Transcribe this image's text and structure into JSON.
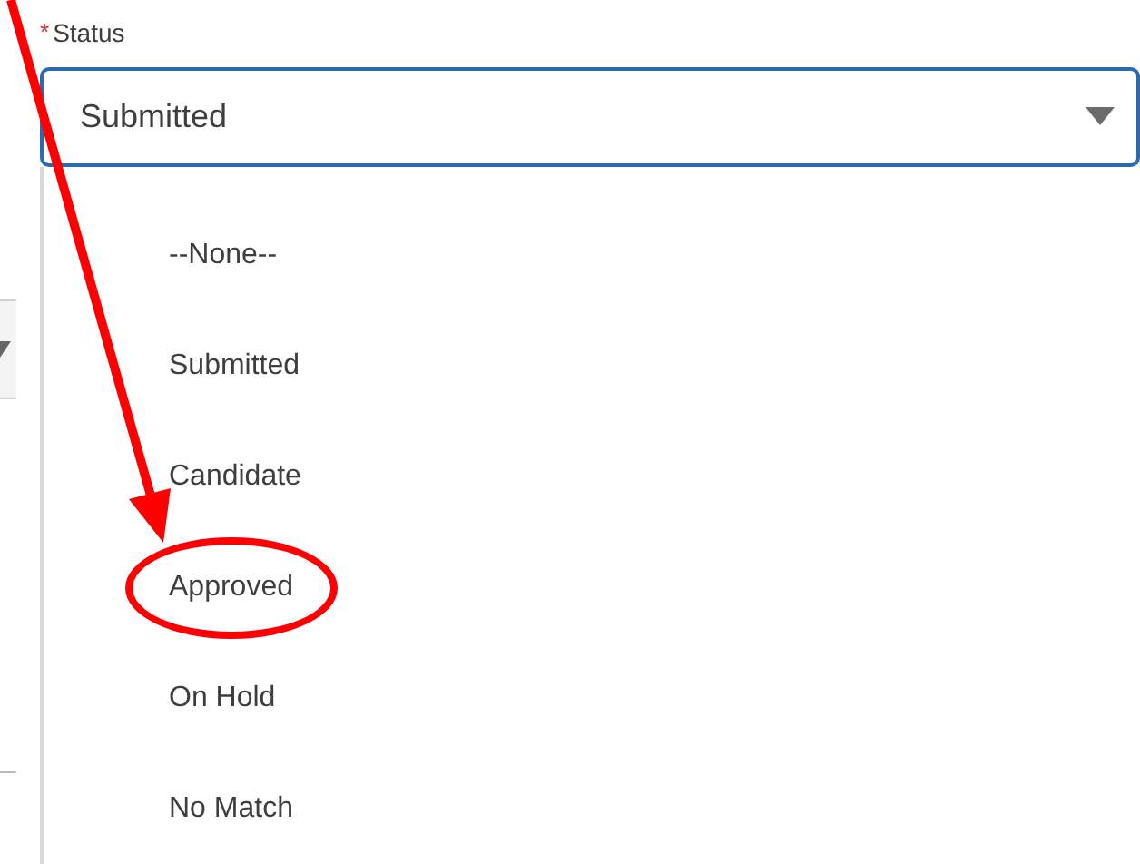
{
  "field": {
    "label": "Status",
    "required_mark": "*",
    "value": "Submitted"
  },
  "options": [
    {
      "label": "--None--",
      "circled": false
    },
    {
      "label": "Submitted",
      "circled": false
    },
    {
      "label": "Candidate",
      "circled": false
    },
    {
      "label": "Approved",
      "circled": true
    },
    {
      "label": "On Hold",
      "circled": false
    },
    {
      "label": "No Match",
      "circled": false
    }
  ]
}
